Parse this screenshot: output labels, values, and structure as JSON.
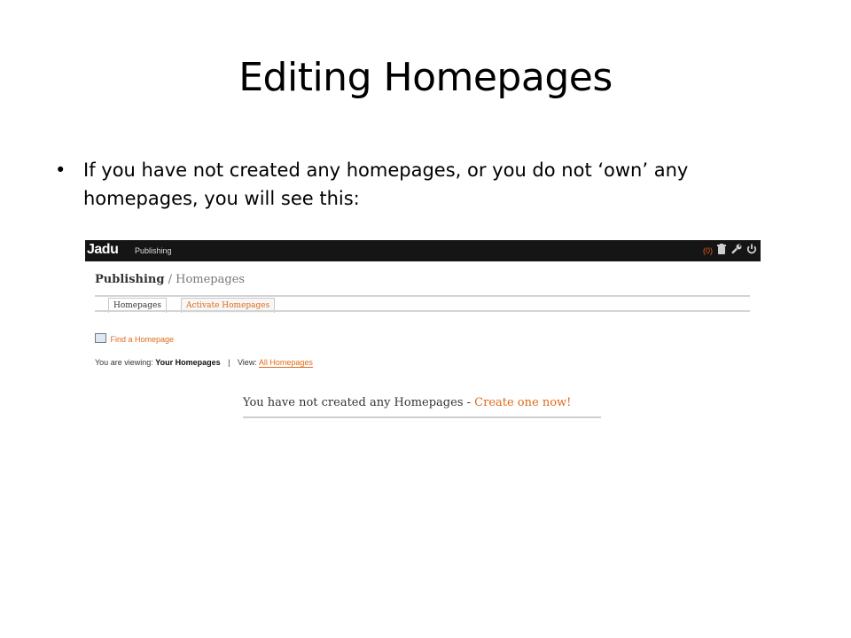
{
  "slide": {
    "title": "Editing Homepages",
    "bullet_symbol": "•",
    "bullet_text": "If you have not created any homepages, or you do not ‘own’ any homepages, you will see this:"
  },
  "screenshot": {
    "topbar": {
      "logo": "Jadu",
      "module": "Publishing",
      "count": "(0)",
      "icons": [
        "trash-icon",
        "wrench-icon",
        "power-icon"
      ]
    },
    "breadcrumb": {
      "current": "Publishing",
      "separator": " / ",
      "page": "Homepages"
    },
    "tabs": [
      {
        "label": "Homepages"
      },
      {
        "label": "Activate Homepages"
      }
    ],
    "find_link": "Find a Homepage",
    "viewing": {
      "label": "You are viewing:",
      "current": "Your Homepages",
      "separator": "|",
      "view_label": "View:",
      "view_link": "All Homepages"
    },
    "empty": {
      "message": "You have not created any Homepages - ",
      "cta": "Create one now!"
    }
  },
  "colors": {
    "accent": "#e06a1a",
    "topbar_bg": "#151515"
  }
}
